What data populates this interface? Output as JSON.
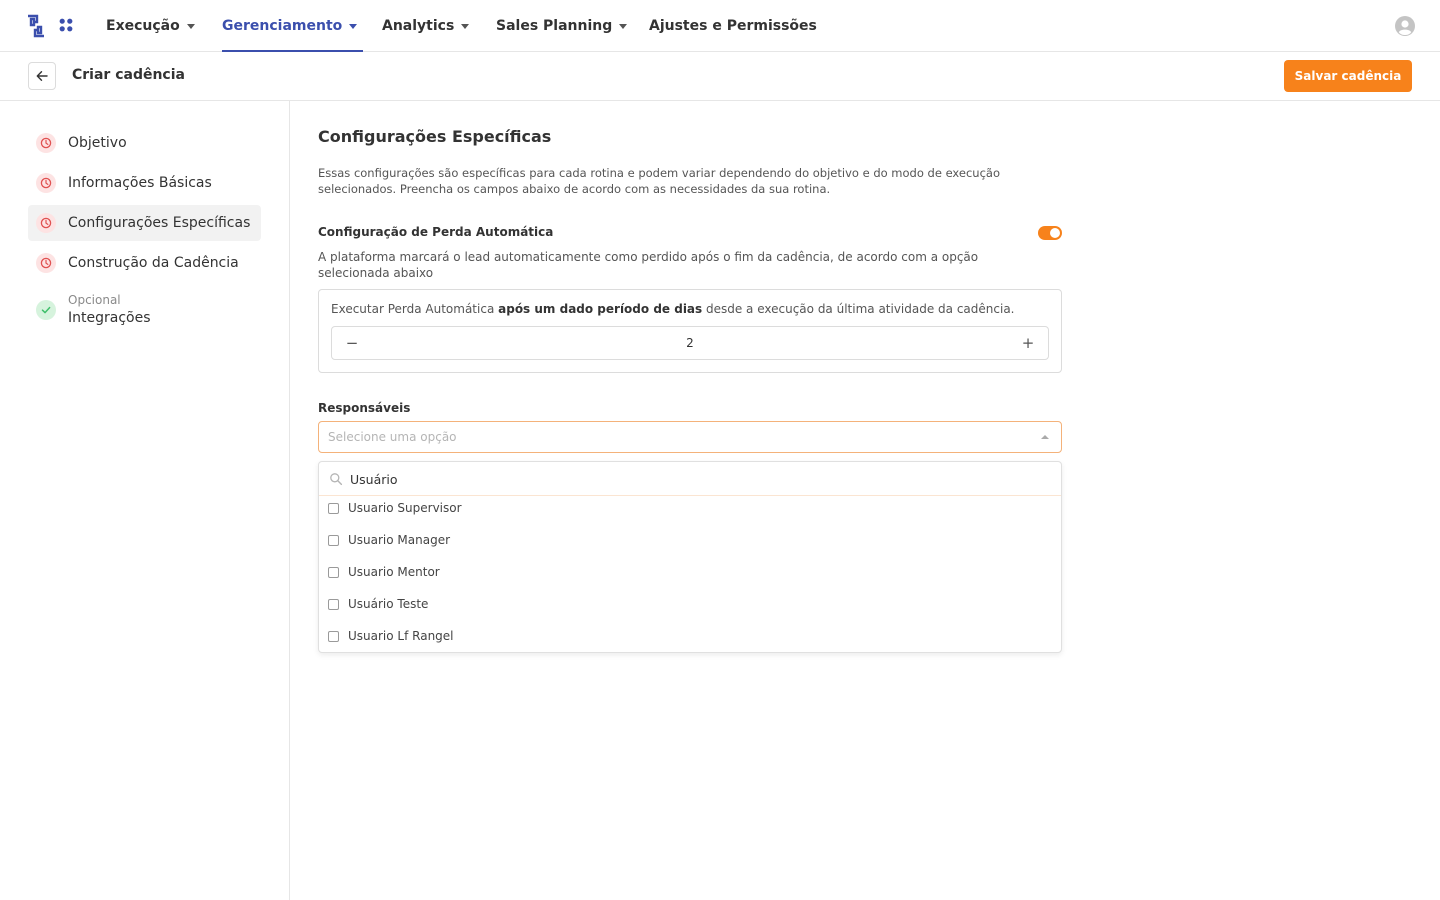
{
  "topnav": {
    "items": [
      {
        "label": "Execução",
        "has_caret": true
      },
      {
        "label": "Gerenciamento",
        "has_caret": true,
        "active": true
      },
      {
        "label": "Analytics",
        "has_caret": true
      },
      {
        "label": "Sales Planning",
        "has_caret": true
      },
      {
        "label": "Ajustes e Permissões",
        "has_caret": false
      }
    ],
    "icons": {
      "logo": "brand-logo-icon",
      "apps": "apps-grid-icon",
      "account": "user-avatar-icon"
    }
  },
  "subheader": {
    "title": "Criar cadência",
    "save_label": "Salvar cadência",
    "back_icon": "arrow-left-icon"
  },
  "sidebar": {
    "items": [
      {
        "label": "Objetivo",
        "status": "pending"
      },
      {
        "label": "Informações Básicas",
        "status": "pending"
      },
      {
        "label": "Configurações Específicas",
        "status": "pending",
        "active": true
      },
      {
        "label": "Construção da Cadência",
        "status": "pending"
      },
      {
        "label": "Integrações",
        "sublabel": "Opcional",
        "status": "done"
      }
    ]
  },
  "main": {
    "title": "Configurações Específicas",
    "description": "Essas configurações são específicas para cada rotina e podem variar dependendo do objetivo e do modo de execução selecionados. Preencha os campos abaixo de acordo com as necessidades da sua rotina.",
    "auto_loss": {
      "title": "Configuração de Perda Automática",
      "enabled": true,
      "description": "A plataforma marcará o lead automaticamente como perdido após o fim da cadência, de acordo com a opção selecionada abaixo",
      "rule_prefix": "Executar Perda Automática ",
      "rule_bold": "após um dado período de dias",
      "rule_suffix": " desde a execução da última atividade da cadência.",
      "days_value": "2",
      "minus_symbol": "−",
      "plus_symbol": "+"
    },
    "responsaveis": {
      "label": "Responsáveis",
      "placeholder": "Selecione uma opção",
      "search_value": "Usuário",
      "options": [
        {
          "label": "Usuario Supervisor",
          "checked": false
        },
        {
          "label": "Usuario Manager",
          "checked": false
        },
        {
          "label": "Usuario Mentor",
          "checked": false
        },
        {
          "label": "Usuário Teste",
          "checked": false
        },
        {
          "label": "Usuario Lf Rangel",
          "checked": false
        }
      ]
    }
  },
  "colors": {
    "brand_blue": "#3b4fad",
    "accent_orange": "#f7821b",
    "pending_red": "#e05252",
    "done_green": "#3fbf6a"
  }
}
